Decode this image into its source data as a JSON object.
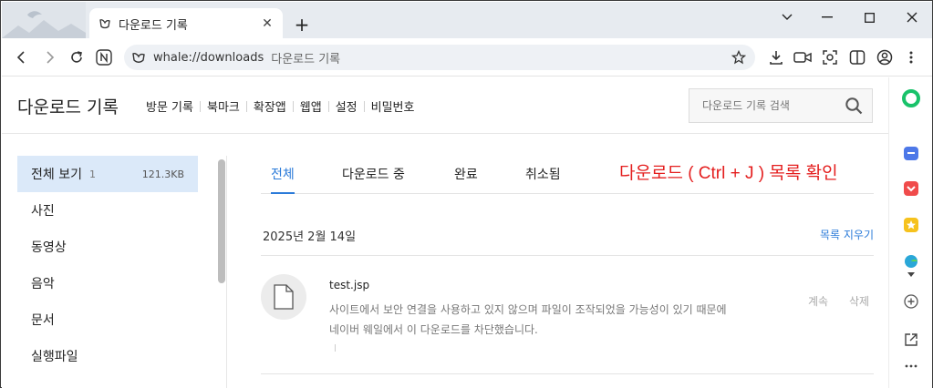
{
  "browser": {
    "tab_title": "다운로드 기록",
    "new_tab_symbol": "+",
    "tab_close_symbol": "✕",
    "url": "whale://downloads",
    "url_label": "다운로드 기록"
  },
  "page": {
    "title": "다운로드 기록",
    "menu": [
      "방문 기록",
      "북마크",
      "확장앱",
      "웹앱",
      "설정",
      "비밀번호"
    ],
    "search_placeholder": "다운로드 기록 검색"
  },
  "categories": [
    {
      "label": "전체 보기",
      "count": "1",
      "size": "121.3KB",
      "active": true
    },
    {
      "label": "사진"
    },
    {
      "label": "동영상"
    },
    {
      "label": "음악"
    },
    {
      "label": "문서"
    },
    {
      "label": "실행파일"
    }
  ],
  "download_tabs": [
    "전체",
    "다운로드 중",
    "완료",
    "취소됨"
  ],
  "annotation": "다운로드 ( Ctrl + J ) 목록 확인",
  "group": {
    "date": "2025년 2월 14일",
    "clear_label": "목록 지우기"
  },
  "item": {
    "filename": "test.jsp",
    "message_line1": "사이트에서 보안 연결을 사용하고 있지 않으며 파일이 조작되었을 가능성이 있기 때문에",
    "message_line2": "네이버 웨일에서 이 다운로드를 차단했습니다.",
    "keep_label": "계속",
    "delete_label": "삭제"
  },
  "colors": {
    "accent": "#2b7bd9",
    "annotation": "#e41e1e",
    "active_category_bg": "#dbe9f9"
  }
}
